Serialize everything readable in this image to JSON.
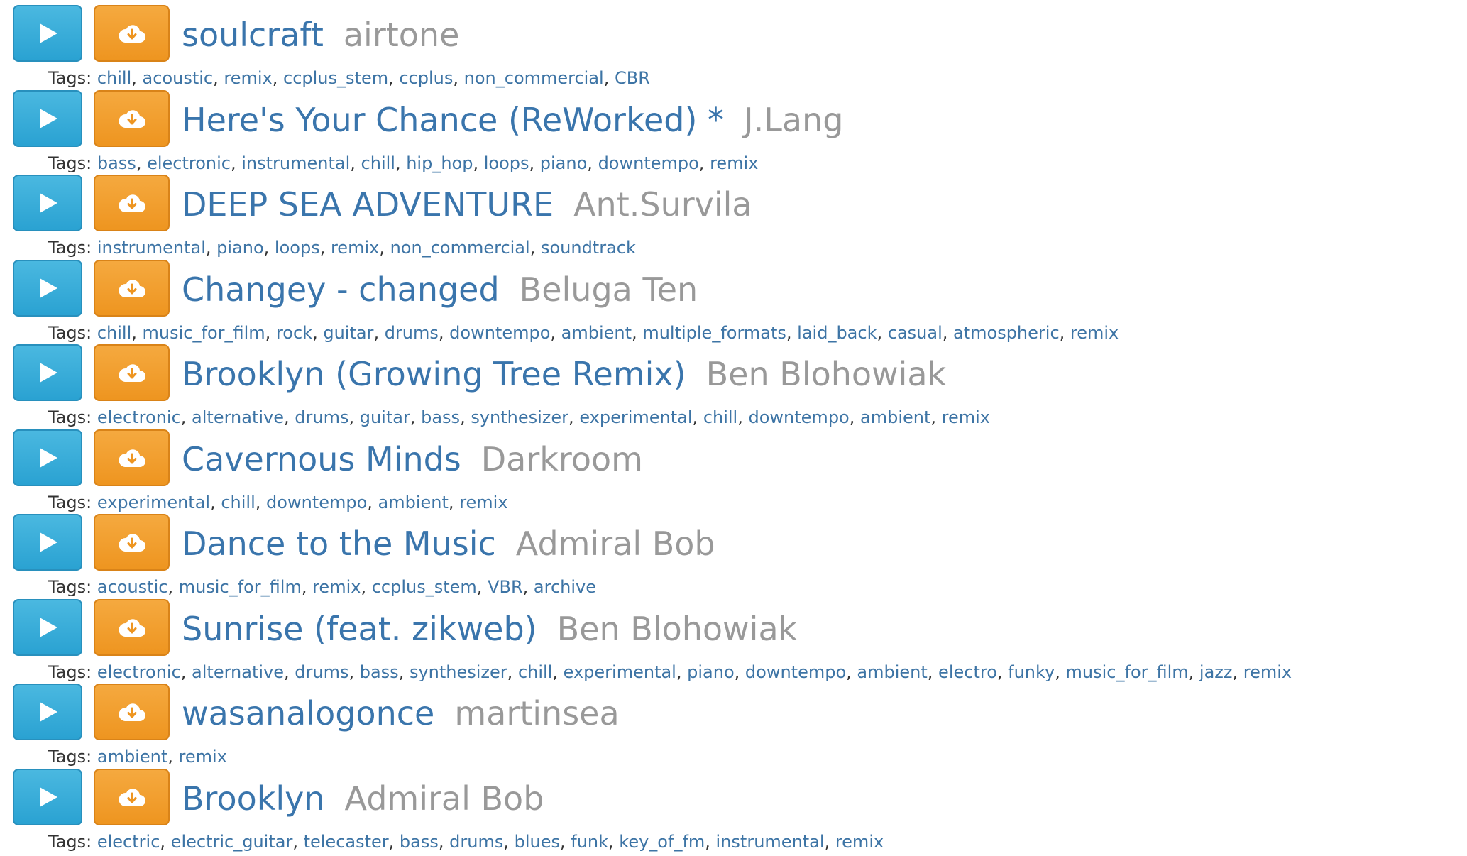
{
  "colors": {
    "play_button": "#2aa2d2",
    "download_button": "#ee9520",
    "title": "#3a75ac",
    "artist": "#999999",
    "tag_link": "#3d74a5",
    "label": "#333333"
  },
  "tags_label": "Tags:",
  "tracks": [
    {
      "title": "soulcraft",
      "artist": "airtone",
      "tags": [
        "chill",
        "acoustic",
        "remix",
        "ccplus_stem",
        "ccplus",
        "non_commercial",
        "CBR"
      ]
    },
    {
      "title": "Here's Your Chance (ReWorked) *",
      "artist": "J.Lang",
      "tags": [
        "bass",
        "electronic",
        "instrumental",
        "chill",
        "hip_hop",
        "loops",
        "piano",
        "downtempo",
        "remix"
      ]
    },
    {
      "title": "DEEP SEA ADVENTURE",
      "artist": "Ant.Survila",
      "tags": [
        "instrumental",
        "piano",
        "loops",
        "remix",
        "non_commercial",
        "soundtrack"
      ]
    },
    {
      "title": "Changey - changed",
      "artist": "Beluga Ten",
      "tags": [
        "chill",
        "music_for_film",
        "rock",
        "guitar",
        "drums",
        "downtempo",
        "ambient",
        "multiple_formats",
        "laid_back",
        "casual",
        "atmospheric",
        "remix"
      ]
    },
    {
      "title": "Brooklyn (Growing Tree Remix)",
      "artist": "Ben Blohowiak",
      "tags": [
        "electronic",
        "alternative",
        "drums",
        "guitar",
        "bass",
        "synthesizer",
        "experimental",
        "chill",
        "downtempo",
        "ambient",
        "remix"
      ]
    },
    {
      "title": "Cavernous Minds",
      "artist": "Darkroom",
      "tags": [
        "experimental",
        "chill",
        "downtempo",
        "ambient",
        "remix"
      ]
    },
    {
      "title": "Dance to the Music",
      "artist": "Admiral Bob",
      "tags": [
        "acoustic",
        "music_for_film",
        "remix",
        "ccplus_stem",
        "VBR",
        "archive"
      ]
    },
    {
      "title": "Sunrise (feat. zikweb)",
      "artist": "Ben Blohowiak",
      "tags": [
        "electronic",
        "alternative",
        "drums",
        "bass",
        "synthesizer",
        "chill",
        "experimental",
        "piano",
        "downtempo",
        "ambient",
        "electro",
        "funky",
        "music_for_film",
        "jazz",
        "remix"
      ]
    },
    {
      "title": "wasanalogonce",
      "artist": "martinsea",
      "tags": [
        "ambient",
        "remix"
      ]
    },
    {
      "title": "Brooklyn",
      "artist": "Admiral Bob",
      "tags": [
        "electric",
        "electric_guitar",
        "telecaster",
        "bass",
        "drums",
        "blues",
        "funk",
        "key_of_fm",
        "instrumental",
        "remix"
      ]
    }
  ],
  "icons": {
    "play": "play-triangle-icon",
    "download": "cloud-download-icon"
  }
}
